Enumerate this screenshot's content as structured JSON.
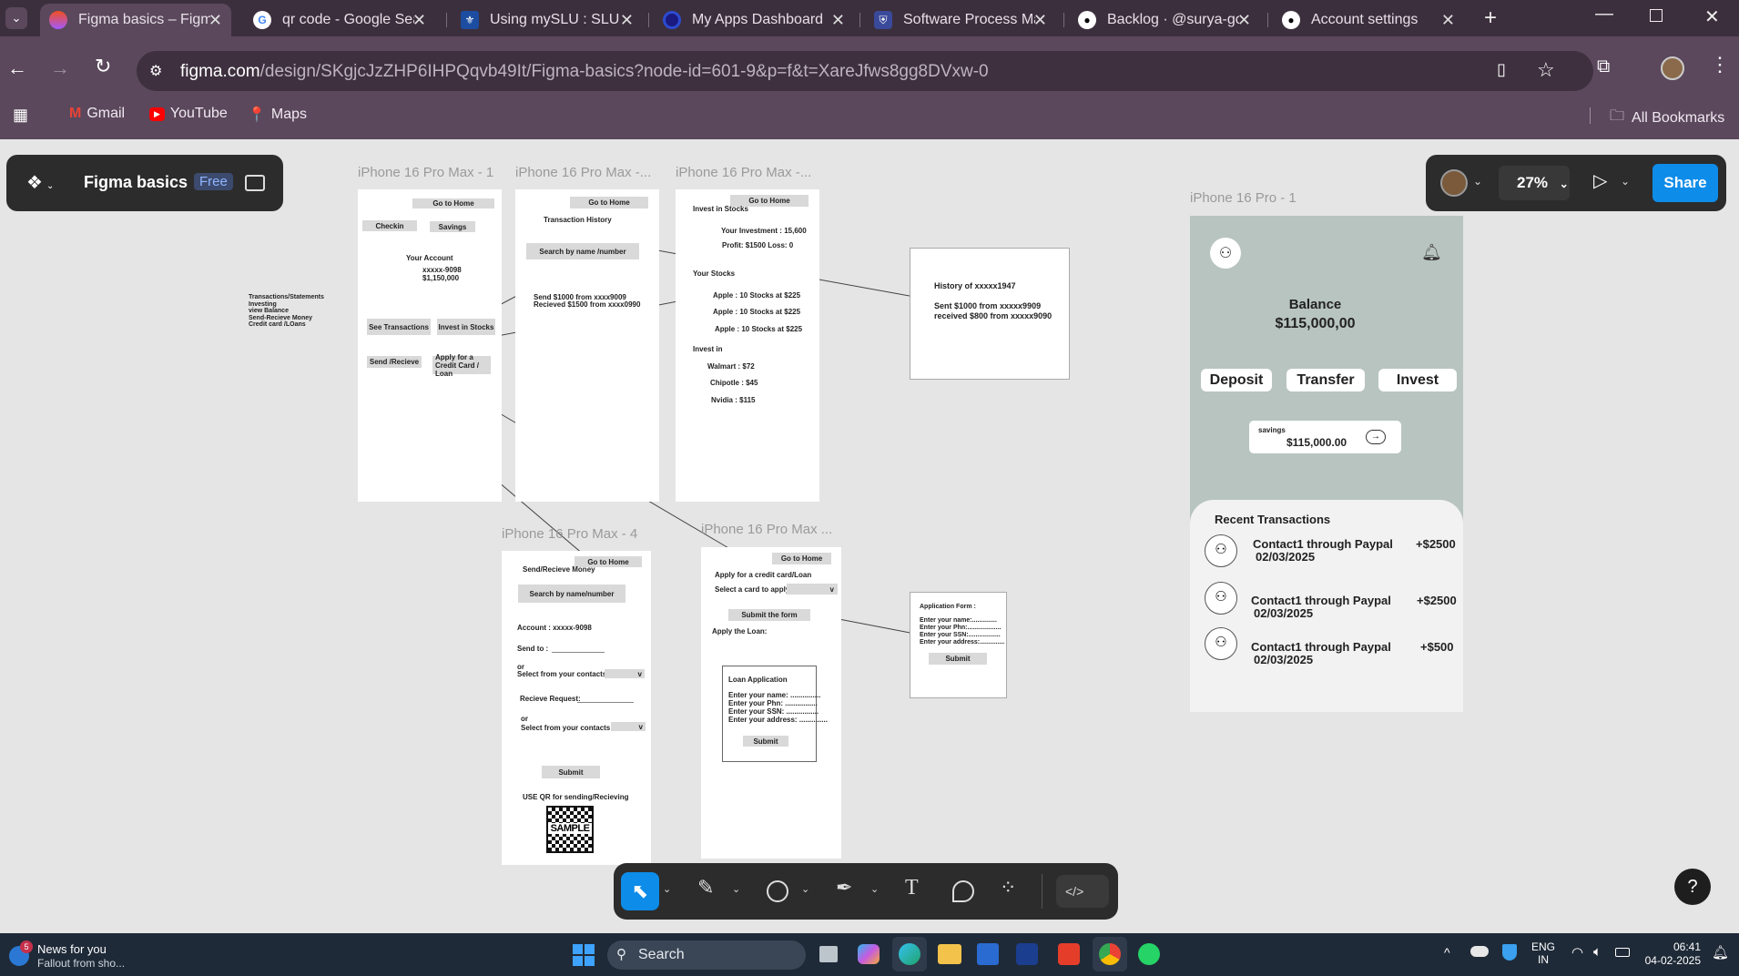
{
  "browser": {
    "tabs": [
      {
        "title": "Figma basics – Figma",
        "icon": "figma-icon",
        "active": true
      },
      {
        "title": "qr code - Google Search",
        "icon": "google-icon"
      },
      {
        "title": "Using mySLU : SLU - Saint Louis",
        "icon": "slu-icon"
      },
      {
        "title": "My Apps Dashboard",
        "icon": "okta-icon"
      },
      {
        "title": "Software Process Management",
        "icon": "shield-icon"
      },
      {
        "title": "Backlog · @surya-gopi",
        "icon": "github-icon"
      },
      {
        "title": "Account settings",
        "icon": "github-icon"
      }
    ],
    "url_host": "figma.com",
    "url_path": "/design/SKgjcJzZHP6IHPQqvb49It/Figma-basics?node-id=601-9&p=f&t=XareJfws8gg8DVxw-0",
    "bookmarks": [
      "Gmail",
      "YouTube",
      "Maps"
    ],
    "all_bookmarks": "All Bookmarks"
  },
  "figma": {
    "file_name": "Figma basics",
    "plan_badge": "Free",
    "zoom": "27%",
    "share_label": "Share",
    "help_label": "?"
  },
  "canvas": {
    "note_lines": [
      "Transactions/Statements",
      "Investing",
      "view Balance",
      "Send-Recieve Money",
      "Credit card /LOans"
    ],
    "frame1": {
      "label": "iPhone 16 Pro Max - 1",
      "go_home": "Go to Home",
      "checkin": "Checkin",
      "savings": "Savings",
      "your_account": "Your Account",
      "account_no": "xxxxx-9098",
      "balance": "$1,150,000",
      "see_transactions": "See Transactions",
      "invest_stocks": "Invest in Stocks",
      "send_recieve": "Send /Recieve",
      "apply_credit": "Apply for a Credit Card / Loan"
    },
    "frame2": {
      "label": "iPhone 16 Pro Max -...",
      "go_home": "Go to Home",
      "title": "Transaction History",
      "search": "Search by name /number",
      "line1": "Send $1000 from xxxx9009",
      "line2": "Recieved $1500 from xxxx0990"
    },
    "frame3": {
      "label": "iPhone 16 Pro Max -...",
      "go_home": "Go to Home",
      "title": "Invest in Stocks",
      "investment": "Your Investment : 15,600",
      "profit": "Profit: $1500 Loss: 0",
      "your_stocks": "Your Stocks",
      "stocks": [
        "Apple  : 10 Stocks at $225",
        "Apple  : 10 Stocks at $225",
        "Apple  : 10 Stocks at $225"
      ],
      "invest_in": "Invest in",
      "options": [
        "Walmart : $72",
        "Chipotle : $45",
        "Nvidia : $115"
      ]
    },
    "history_box": {
      "title": "History of xxxxx1947",
      "line1": "Sent $1000 from xxxxx9909",
      "line2": "received $800 from xxxxx9090"
    },
    "frame4": {
      "label": "iPhone 16 Pro Max - 4",
      "go_home": "Go to Home",
      "title": "Send/Recieve Money",
      "search": "Search by name/number",
      "account": "Account : xxxxx-9098",
      "send_to": "Send to :",
      "or1": "or",
      "select1": "Select from your contacts :",
      "recieve_request": "Recieve Request:",
      "or2": "or",
      "select2": "Select from your contacts:",
      "submit": "Submit",
      "qr_note": "USE QR for sending/Recieving",
      "qr_text": "SAMPLE"
    },
    "frame5": {
      "label": "iPhone 16 Pro Max ...",
      "go_home": "Go to Home",
      "title": "Apply for a credit card/Loan",
      "select_card": "Select a card to apply:",
      "dropdown": "v",
      "submit_form": "Submit the form",
      "apply_loan": "Apply the Loan:",
      "loan_title": "Loan Application",
      "fields": [
        "Enter your name: ...............",
        "Enter your Phn: ................",
        "Enter your SSN: ................",
        "Enter your address: .............."
      ],
      "submit": "Submit"
    },
    "app_form": {
      "title": "Application Form :",
      "fields": [
        "Enter your name:..............",
        "Enter your Phn:...................",
        "Enter your SSN:..................",
        "Enter your address:.............."
      ],
      "submit": "Submit"
    },
    "phone": {
      "label": "iPhone 16 Pro - 1",
      "balance_label": "Balance",
      "balance_value": "$115,000,00",
      "deposit": "Deposit",
      "transfer": "Transfer",
      "invest": "Invest",
      "savings_label": "savings",
      "savings_value": "$115,000.00",
      "recent_title": "Recent Transactions",
      "transactions": [
        {
          "name": "Contact1 through Paypal",
          "date": "02/03/2025",
          "amount": "+$2500"
        },
        {
          "name": "Contact1 through Paypal",
          "date": "02/03/2025",
          "amount": "+$2500"
        },
        {
          "name": "Contact1 through Paypal",
          "date": "02/03/2025",
          "amount": "+$500"
        }
      ],
      "bg_color": "#b8c4bf"
    }
  },
  "taskbar": {
    "news_title": "News for you",
    "news_sub": "Fallout from sho...",
    "news_badge": "5",
    "search": "Search",
    "lang1": "ENG",
    "lang2": "IN",
    "time": "06:41",
    "date": "04-02-2025"
  }
}
